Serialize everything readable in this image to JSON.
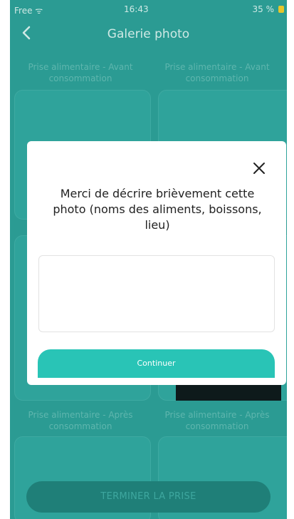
{
  "status_bar": {
    "carrier": "Free",
    "time": "16:43",
    "battery": "35 %"
  },
  "header": {
    "title": "Galerie photo"
  },
  "gallery": {
    "labels": [
      "Prise alimentaire - Avant consommation",
      "Prise alimentaire - Avant consommation",
      "Prise alimentaire - Après consommation",
      "Prise alimentaire - Après consommation"
    ]
  },
  "bottom_button": {
    "label": "TERMINER LA PRISE"
  },
  "modal": {
    "prompt": "Merci de décrire brièvement cette photo (noms des aliments, boissons, lieu)",
    "textarea_value": "",
    "continue_label": "Continuer"
  },
  "colors": {
    "overlay": "#2b9b93",
    "accent": "#29c4b6"
  },
  "icons": {
    "back": "chevron-left-icon",
    "close": "close-icon",
    "wifi": "wifi-icon"
  }
}
